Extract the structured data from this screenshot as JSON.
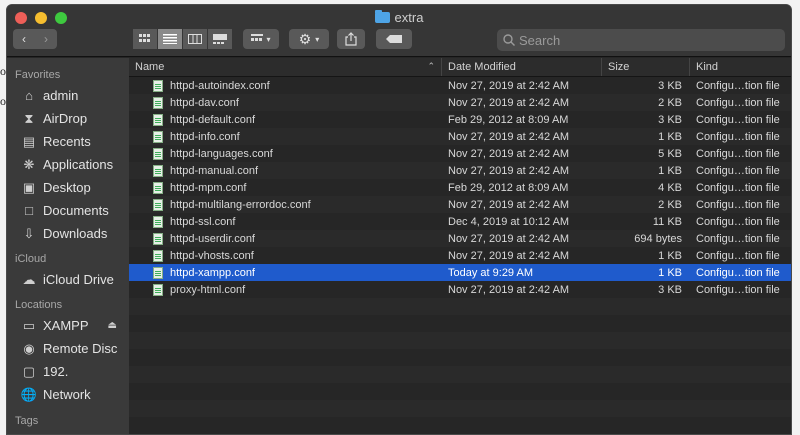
{
  "window": {
    "title": "extra"
  },
  "toolbar": {
    "view_buttons": [
      "icon-view",
      "list-view",
      "column-view",
      "gallery-view"
    ],
    "group_button": "group-by",
    "action_button": "action-menu",
    "share_button": "share",
    "tag_button": "tags"
  },
  "search": {
    "placeholder": "Search"
  },
  "sidebar": {
    "favorites_header": "Favorites",
    "favorites": [
      {
        "label": "admin",
        "icon": "home-icon"
      },
      {
        "label": "AirDrop",
        "icon": "airdrop-icon"
      },
      {
        "label": "Recents",
        "icon": "recents-icon"
      },
      {
        "label": "Applications",
        "icon": "applications-icon"
      },
      {
        "label": "Desktop",
        "icon": "desktop-icon"
      },
      {
        "label": "Documents",
        "icon": "documents-icon"
      },
      {
        "label": "Downloads",
        "icon": "downloads-icon"
      }
    ],
    "icloud_header": "iCloud",
    "icloud": [
      {
        "label": "iCloud Drive",
        "icon": "cloud-icon"
      }
    ],
    "locations_header": "Locations",
    "locations": [
      {
        "label": "XAMPP",
        "icon": "disk-icon"
      },
      {
        "label": "Remote Disc",
        "icon": "remote-disc-icon"
      },
      {
        "label": "192.",
        "icon": "server-icon"
      },
      {
        "label": "Network",
        "icon": "network-icon"
      }
    ],
    "tags_header": "Tags"
  },
  "columns": {
    "name": "Name",
    "date": "Date Modified",
    "size": "Size",
    "kind": "Kind"
  },
  "files": [
    {
      "name": "httpd-autoindex.conf",
      "date": "Nov 27, 2019 at 2:42 AM",
      "size": "3 KB",
      "kind": "Configu…tion file"
    },
    {
      "name": "httpd-dav.conf",
      "date": "Nov 27, 2019 at 2:42 AM",
      "size": "2 KB",
      "kind": "Configu…tion file"
    },
    {
      "name": "httpd-default.conf",
      "date": "Feb 29, 2012 at 8:09 AM",
      "size": "3 KB",
      "kind": "Configu…tion file"
    },
    {
      "name": "httpd-info.conf",
      "date": "Nov 27, 2019 at 2:42 AM",
      "size": "1 KB",
      "kind": "Configu…tion file"
    },
    {
      "name": "httpd-languages.conf",
      "date": "Nov 27, 2019 at 2:42 AM",
      "size": "5 KB",
      "kind": "Configu…tion file"
    },
    {
      "name": "httpd-manual.conf",
      "date": "Nov 27, 2019 at 2:42 AM",
      "size": "1 KB",
      "kind": "Configu…tion file"
    },
    {
      "name": "httpd-mpm.conf",
      "date": "Feb 29, 2012 at 8:09 AM",
      "size": "4 KB",
      "kind": "Configu…tion file"
    },
    {
      "name": "httpd-multilang-errordoc.conf",
      "date": "Nov 27, 2019 at 2:42 AM",
      "size": "2 KB",
      "kind": "Configu…tion file"
    },
    {
      "name": "httpd-ssl.conf",
      "date": "Dec 4, 2019 at 10:12 AM",
      "size": "11 KB",
      "kind": "Configu…tion file"
    },
    {
      "name": "httpd-userdir.conf",
      "date": "Nov 27, 2019 at 2:42 AM",
      "size": "694 bytes",
      "kind": "Configu…tion file"
    },
    {
      "name": "httpd-vhosts.conf",
      "date": "Nov 27, 2019 at 2:42 AM",
      "size": "1 KB",
      "kind": "Configu…tion file"
    },
    {
      "name": "httpd-xampp.conf",
      "date": "Today at 9:29 AM",
      "size": "1 KB",
      "kind": "Configu…tion file",
      "selected": true
    },
    {
      "name": "proxy-html.conf",
      "date": "Nov 27, 2019 at 2:42 AM",
      "size": "3 KB",
      "kind": "Configu…tion file"
    }
  ],
  "colors": {
    "selection": "#1f5bcc",
    "sidebar_bg": "#3a3a3a",
    "content_bg": "#262626"
  }
}
